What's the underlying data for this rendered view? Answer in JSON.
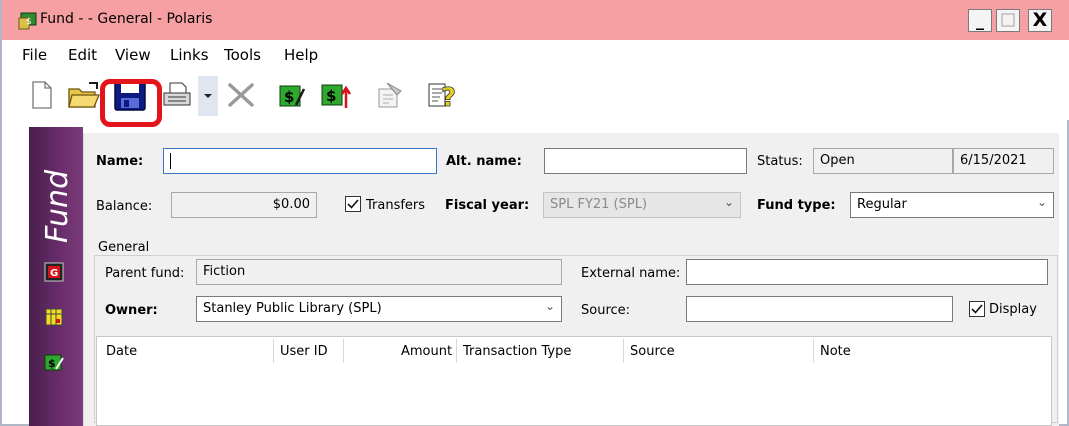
{
  "window": {
    "title": "Fund -  - General - Polaris",
    "min_label": "_",
    "max_label": "☐",
    "close_label": "X"
  },
  "menu": [
    "File",
    "Edit",
    "View",
    "Links",
    "Tools",
    "Help"
  ],
  "toolbar": {
    "icons": [
      "new-document-icon",
      "open-folder-icon",
      "save-icon",
      "print-icon",
      "dropdown-arrow-icon",
      "delete-icon",
      "fund-edit-icon",
      "fund-transfer-icon",
      "properties-icon",
      "help-icon"
    ],
    "highlighted": "save-icon"
  },
  "sidebar": {
    "caption": "Fund",
    "icons": [
      "general-tab-icon",
      "calendar-tab-icon",
      "transactions-tab-icon"
    ]
  },
  "form": {
    "name_label": "Name:",
    "name_value": "",
    "alt_name_label": "Alt. name:",
    "alt_name_value": "",
    "status_label": "Status:",
    "status_value": "Open",
    "status_date": "6/15/2021",
    "balance_label": "Balance:",
    "balance_value": "$0.00",
    "transfers_label": "Transfers",
    "transfers_checked": true,
    "fiscal_year_label": "Fiscal year:",
    "fiscal_year_value": "SPL FY21 (SPL)",
    "fund_type_label": "Fund type:",
    "fund_type_value": "Regular"
  },
  "general": {
    "group_title": "General",
    "parent_fund_label": "Parent fund:",
    "parent_fund_value": "Fiction",
    "external_name_label": "External name:",
    "external_name_value": "",
    "owner_label": "Owner:",
    "owner_value": "Stanley Public Library (SPL)",
    "source_label": "Source:",
    "source_value": "",
    "display_label": "Display",
    "display_checked": true
  },
  "table": {
    "columns": [
      "Date",
      "User ID",
      "Amount",
      "Transaction Type",
      "Source",
      "Note"
    ],
    "rows": []
  },
  "colors": {
    "titlebar": "#f6a0a3",
    "sidebar": "#5a2a5c",
    "highlight": "#e3141b",
    "panel": "#f0f0f0"
  }
}
